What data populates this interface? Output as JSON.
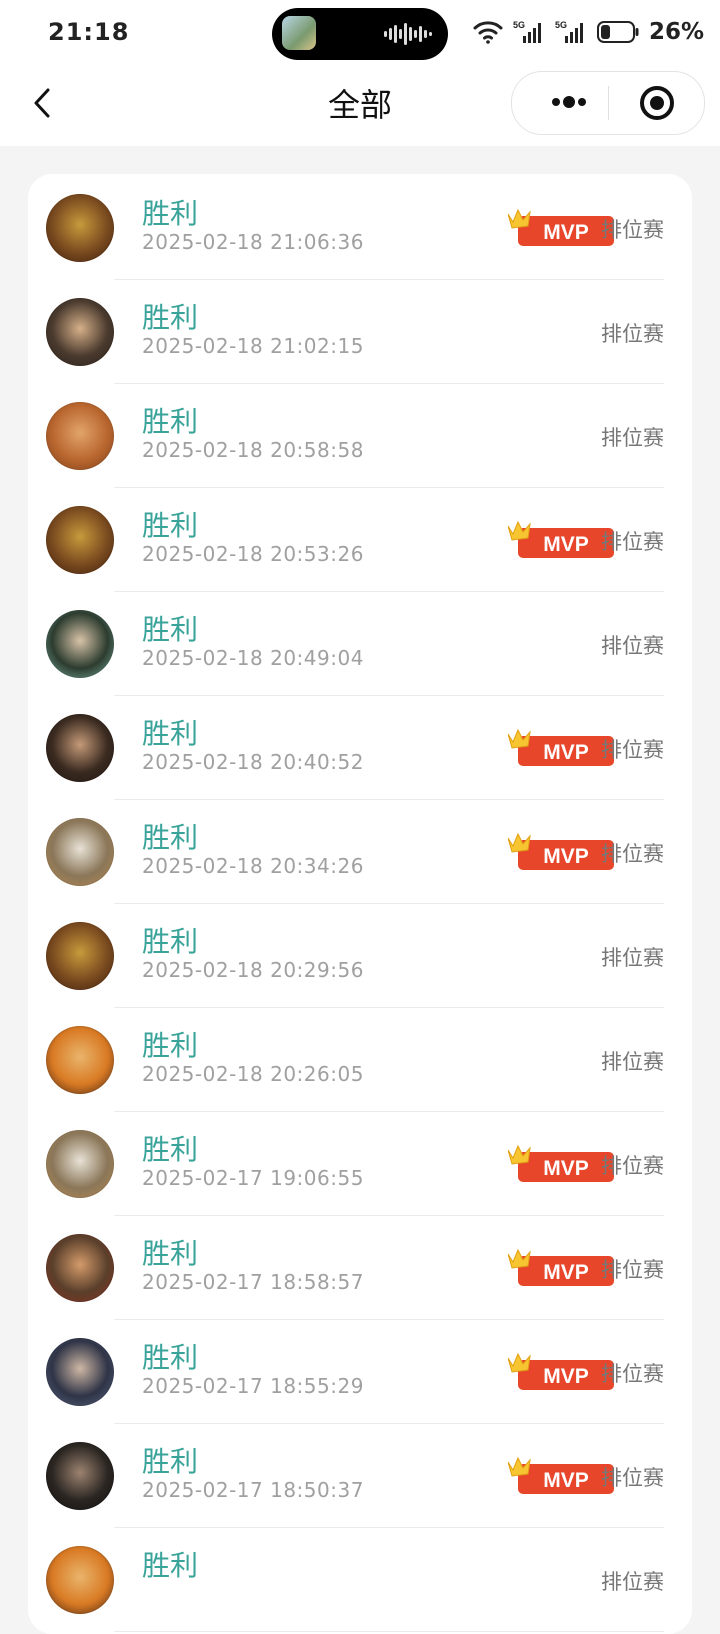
{
  "status_bar": {
    "time": "21:18",
    "battery": "26%",
    "icons": [
      "wifi-icon",
      "5g-signal-icon",
      "5g-signal-icon",
      "battery-icon"
    ]
  },
  "nav": {
    "title": "全部",
    "back_icon": "chevron-left-icon",
    "more_icon": "more-dots-icon",
    "close_icon": "target-icon"
  },
  "colors": {
    "result": "#3aa39a",
    "mvp_badge": "#e7462b",
    "mvp_crown": "#f7c531"
  },
  "matches": [
    {
      "result": "胜利",
      "time": "2025-02-18 21:06:36",
      "mvp": true,
      "mode": "排位赛",
      "avatar_colors": [
        "#7a4b1f",
        "#c79a3c",
        "#3b1a0c"
      ]
    },
    {
      "result": "胜利",
      "time": "2025-02-18 21:02:15",
      "mvp": false,
      "mode": "排位赛",
      "avatar_colors": [
        "#4a3a2e",
        "#d6b089",
        "#2a1f1a"
      ]
    },
    {
      "result": "胜利",
      "time": "2025-02-18 20:58:58",
      "mvp": false,
      "mode": "排位赛",
      "avatar_colors": [
        "#b8662e",
        "#e2a46b",
        "#7a3d1b"
      ]
    },
    {
      "result": "胜利",
      "time": "2025-02-18 20:53:26",
      "mvp": true,
      "mode": "排位赛",
      "avatar_colors": [
        "#7a4b1f",
        "#c79a3c",
        "#3b1a0c"
      ]
    },
    {
      "result": "胜利",
      "time": "2025-02-18 20:49:04",
      "mvp": false,
      "mode": "排位赛",
      "avatar_colors": [
        "#2c3c2f",
        "#d8c3a8",
        "#7fb3a4"
      ]
    },
    {
      "result": "胜利",
      "time": "2025-02-18 20:40:52",
      "mvp": true,
      "mode": "排位赛",
      "avatar_colors": [
        "#3a2a20",
        "#c59a78",
        "#1e1510"
      ]
    },
    {
      "result": "胜利",
      "time": "2025-02-18 20:34:26",
      "mvp": true,
      "mode": "排位赛",
      "avatar_colors": [
        "#8a7658",
        "#e8e2d6",
        "#b98a53"
      ]
    },
    {
      "result": "胜利",
      "time": "2025-02-18 20:29:56",
      "mvp": false,
      "mode": "排位赛",
      "avatar_colors": [
        "#7a4b1f",
        "#c79a3c",
        "#3b1a0c"
      ]
    },
    {
      "result": "胜利",
      "time": "2025-02-18 20:26:05",
      "mvp": false,
      "mode": "排位赛",
      "avatar_colors": [
        "#d97a24",
        "#e9b56c",
        "#3b1f10"
      ]
    },
    {
      "result": "胜利",
      "time": "2025-02-17 19:06:55",
      "mvp": true,
      "mode": "排位赛",
      "avatar_colors": [
        "#8a7658",
        "#e8e2d6",
        "#b98a53"
      ]
    },
    {
      "result": "胜利",
      "time": "2025-02-17 18:58:57",
      "mvp": true,
      "mode": "排位赛",
      "avatar_colors": [
        "#5a3f2b",
        "#d49b6a",
        "#8a2e1f"
      ]
    },
    {
      "result": "胜利",
      "time": "2025-02-17 18:55:29",
      "mvp": true,
      "mode": "排位赛",
      "avatar_colors": [
        "#2f3447",
        "#cfb8a5",
        "#5a6380"
      ]
    },
    {
      "result": "胜利",
      "time": "2025-02-17 18:50:37",
      "mvp": true,
      "mode": "排位赛",
      "avatar_colors": [
        "#2b2622",
        "#9c8370",
        "#0f0c0a"
      ]
    },
    {
      "result": "胜利",
      "time": "",
      "mvp": false,
      "mode": "排位赛",
      "avatar_colors": [
        "#d97a24",
        "#e9b56c",
        "#3b1f10"
      ]
    }
  ],
  "mvp_label": "MVP"
}
